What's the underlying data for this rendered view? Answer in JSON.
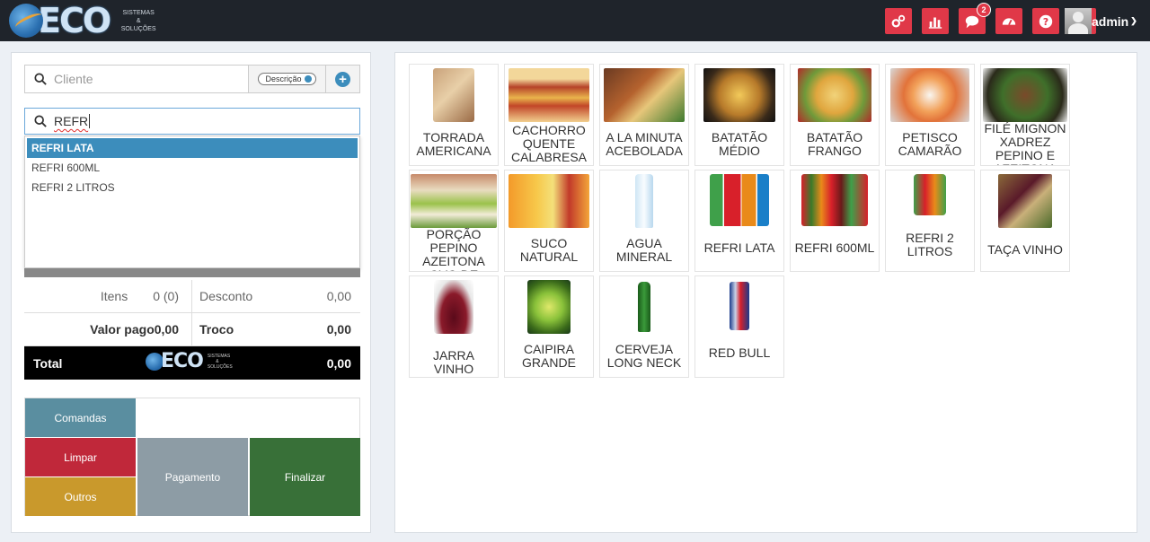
{
  "brand": {
    "name": "ECO",
    "subtitle": "SISTEMAS & SOLUÇÕES"
  },
  "topbar": {
    "icons": [
      "settings-cogs-icon",
      "bar-chart-icon",
      "chat-icon",
      "dashboard-icon",
      "help-icon",
      "image-icon"
    ],
    "chat_badge": "2",
    "user_name": "admin"
  },
  "client": {
    "placeholder": "Cliente",
    "desc_toggle": "Descrição"
  },
  "search": {
    "value": "REFR",
    "results": [
      "REFRI LATA",
      "REFRI 600ML",
      "REFRI 2 LITROS"
    ]
  },
  "totals": {
    "itens_label": "Itens",
    "itens_value": "0 (0)",
    "desconto_label": "Desconto",
    "desconto_value": "0,00",
    "valor_pago_label": "Valor pago",
    "valor_pago_value": "0,00",
    "troco_label": "Troco",
    "troco_value": "0,00",
    "total_label": "Total",
    "total_value": "0,00"
  },
  "actions": {
    "comandas": "Comandas",
    "limpar": "Limpar",
    "outros": "Outros",
    "pagamento": "Pagamento",
    "finalizar": "Finalizar"
  },
  "products": [
    "TORRADA AMERICANA",
    "CACHORRO QUENTE CALABRESA",
    "A LA MINUTA ACEBOLADA",
    "BATATÃO MÉDIO",
    "BATATÃO FRANGO",
    "PETISCO CAMARÃO",
    "FILÉ MIGNON XADREZ PEPINO E AZEITONA",
    "PORÇÃO PEPINO AZEITONA OVO DE",
    "SUCO NATURAL",
    "AGUA MINERAL",
    "REFRI LATA",
    "REFRI 600ML",
    "REFRI 2 LITROS",
    "TAÇA VINHO",
    "JARRA VINHO",
    "CAIPIRA GRANDE",
    "CERVEJA LONG NECK",
    "RED BULL"
  ],
  "colors": {
    "topbar": "#1f242b",
    "icon_red": "#e03848",
    "accent_blue": "#3c8dbc",
    "finalizar": "#387038",
    "limpar": "#c0283a"
  }
}
